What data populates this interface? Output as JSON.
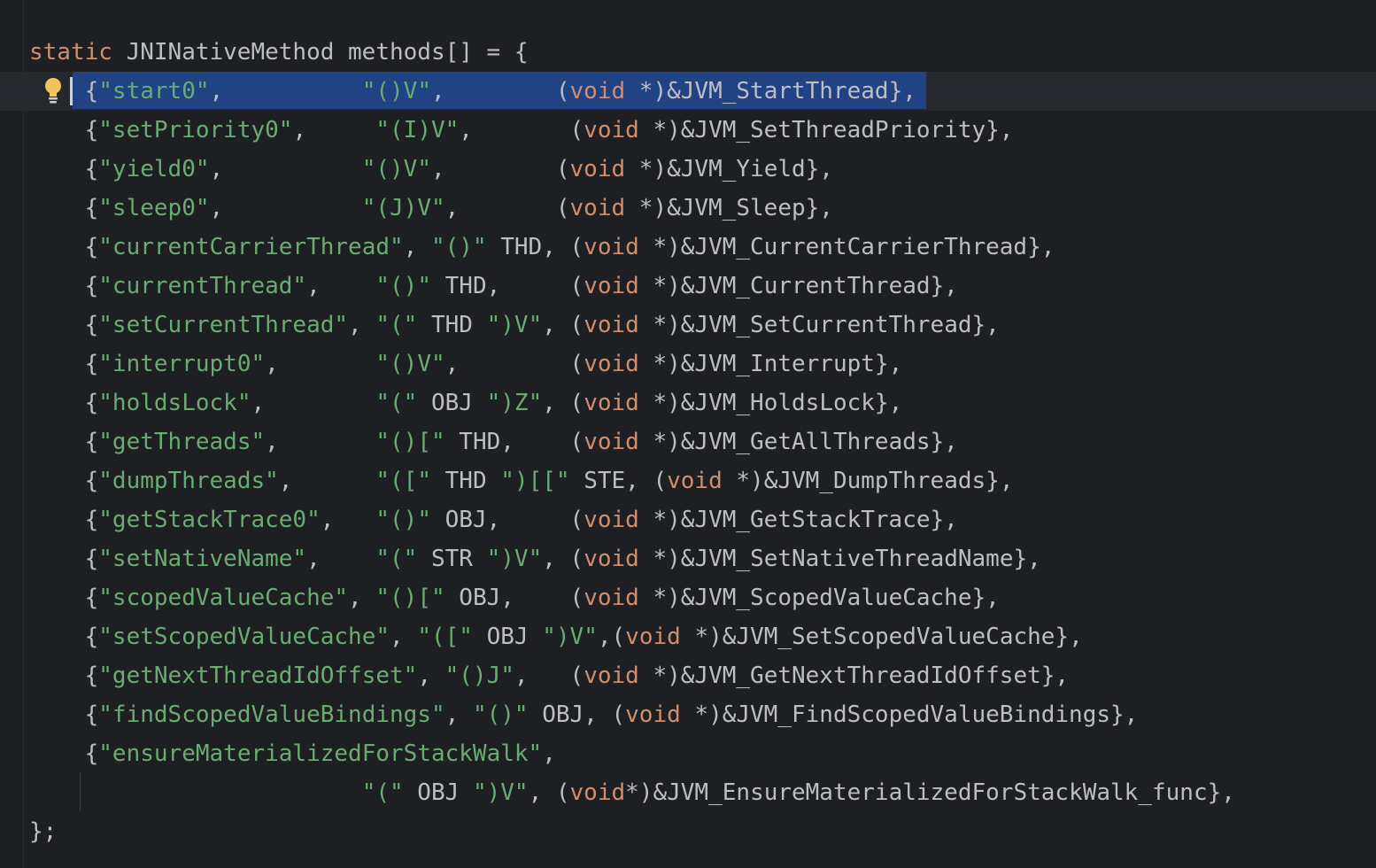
{
  "editor": {
    "lines": [
      [
        "static",
        " JNINativeMethod methods[] = {"
      ],
      [
        "    {",
        "\"start0\"",
        ",          ",
        "\"()V\"",
        ",        (",
        "void",
        " *)&JVM_StartThread},"
      ],
      [
        "    {",
        "\"setPriority0\"",
        ",     ",
        "\"(I)V\"",
        ",       (",
        "void",
        " *)&JVM_SetThreadPriority},"
      ],
      [
        "    {",
        "\"yield0\"",
        ",          ",
        "\"()V\"",
        ",        (",
        "void",
        " *)&JVM_Yield},"
      ],
      [
        "    {",
        "\"sleep0\"",
        ",          ",
        "\"(J)V\"",
        ",       (",
        "void",
        " *)&JVM_Sleep},"
      ],
      [
        "    {",
        "\"currentCarrierThread\"",
        ", ",
        "\"()\"",
        " THD, (",
        "void",
        " *)&JVM_CurrentCarrierThread},"
      ],
      [
        "    {",
        "\"currentThread\"",
        ",    ",
        "\"()\"",
        " THD,     (",
        "void",
        " *)&JVM_CurrentThread},"
      ],
      [
        "    {",
        "\"setCurrentThread\"",
        ", ",
        "\"(\"",
        " THD ",
        "\")V\"",
        ", (",
        "void",
        " *)&JVM_SetCurrentThread},"
      ],
      [
        "    {",
        "\"interrupt0\"",
        ",       ",
        "\"()V\"",
        ",        (",
        "void",
        " *)&JVM_Interrupt},"
      ],
      [
        "    {",
        "\"holdsLock\"",
        ",        ",
        "\"(\"",
        " OBJ ",
        "\")Z\"",
        ", (",
        "void",
        " *)&JVM_HoldsLock},"
      ],
      [
        "    {",
        "\"getThreads\"",
        ",       ",
        "\"()[\"",
        " THD,    (",
        "void",
        " *)&JVM_GetAllThreads},"
      ],
      [
        "    {",
        "\"dumpThreads\"",
        ",      ",
        "\"([\"",
        " THD ",
        "\")[[\"",
        " STE, (",
        "void",
        " *)&JVM_DumpThreads},"
      ],
      [
        "    {",
        "\"getStackTrace0\"",
        ",   ",
        "\"()\"",
        " OBJ,     (",
        "void",
        " *)&JVM_GetStackTrace},"
      ],
      [
        "    {",
        "\"setNativeName\"",
        ",    ",
        "\"(\"",
        " STR ",
        "\")V\"",
        ", (",
        "void",
        " *)&JVM_SetNativeThreadName},"
      ],
      [
        "    {",
        "\"scopedValueCache\"",
        ", ",
        "\"()[\"",
        " OBJ,    (",
        "void",
        " *)&JVM_ScopedValueCache},"
      ],
      [
        "    {",
        "\"setScopedValueCache\"",
        ", ",
        "\"([\"",
        " OBJ ",
        "\")V\"",
        ",(",
        "void",
        " *)&JVM_SetScopedValueCache},"
      ],
      [
        "    {",
        "\"getNextThreadIdOffset\"",
        ", ",
        "\"()J\"",
        ",   (",
        "void",
        " *)&JVM_GetNextThreadIdOffset},"
      ],
      [
        "    {",
        "\"findScopedValueBindings\"",
        ", ",
        "\"()\"",
        " OBJ, (",
        "void",
        " *)&JVM_FindScopedValueBindings},"
      ],
      [
        "    {",
        "\"ensureMaterializedForStackWalk\"",
        ","
      ],
      [
        "                        ",
        "\"(\"",
        " OBJ ",
        "\")V\"",
        ", (",
        "void",
        "*)&JVM_EnsureMaterializedForStackWalk_func},"
      ],
      [
        "};"
      ]
    ],
    "kinds": [
      [
        "kw",
        "id"
      ],
      [
        "p",
        "str",
        "p",
        "str",
        "p",
        "kw",
        "id"
      ],
      [
        "p",
        "str",
        "p",
        "str",
        "p",
        "kw",
        "id"
      ],
      [
        "p",
        "str",
        "p",
        "str",
        "p",
        "kw",
        "id"
      ],
      [
        "p",
        "str",
        "p",
        "str",
        "p",
        "kw",
        "id"
      ],
      [
        "p",
        "str",
        "p",
        "str",
        "id",
        "kw",
        "id"
      ],
      [
        "p",
        "str",
        "p",
        "str",
        "id",
        "kw",
        "id"
      ],
      [
        "p",
        "str",
        "p",
        "str",
        "id",
        "str",
        "p",
        "kw",
        "id"
      ],
      [
        "p",
        "str",
        "p",
        "str",
        "p",
        "kw",
        "id"
      ],
      [
        "p",
        "str",
        "p",
        "str",
        "id",
        "str",
        "p",
        "kw",
        "id"
      ],
      [
        "p",
        "str",
        "p",
        "str",
        "id",
        "kw",
        "id"
      ],
      [
        "p",
        "str",
        "p",
        "str",
        "id",
        "str",
        "id",
        "kw",
        "id"
      ],
      [
        "p",
        "str",
        "p",
        "str",
        "id",
        "kw",
        "id"
      ],
      [
        "p",
        "str",
        "p",
        "str",
        "id",
        "str",
        "p",
        "kw",
        "id"
      ],
      [
        "p",
        "str",
        "p",
        "str",
        "id",
        "kw",
        "id"
      ],
      [
        "p",
        "str",
        "p",
        "str",
        "id",
        "str",
        "p",
        "kw",
        "id"
      ],
      [
        "p",
        "str",
        "p",
        "str",
        "p",
        "kw",
        "id"
      ],
      [
        "p",
        "str",
        "p",
        "str",
        "id",
        "kw",
        "id"
      ],
      [
        "p",
        "str",
        "p"
      ],
      [
        "p",
        "str",
        "id",
        "str",
        "p",
        "kw",
        "id"
      ],
      [
        "p"
      ]
    ],
    "selected_line": 1,
    "gutter_icon": "lightbulb-icon"
  }
}
